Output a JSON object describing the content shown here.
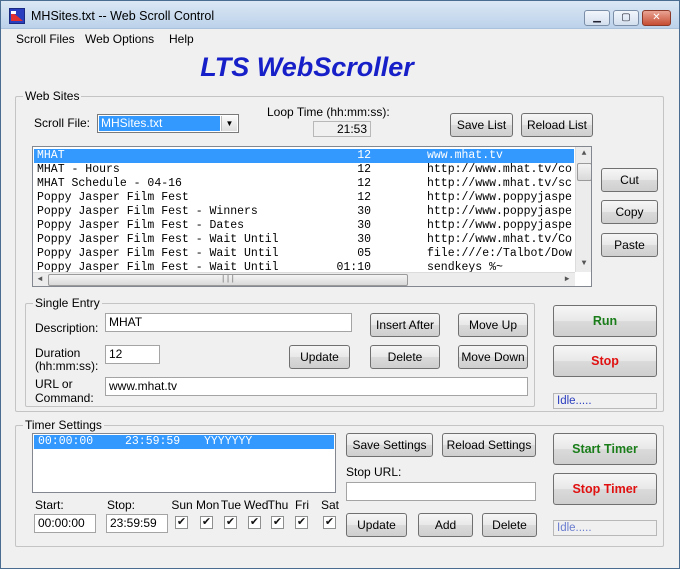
{
  "window": {
    "title": "MHSites.txt -- Web Scroll Control"
  },
  "menu": [
    "Scroll Files",
    "Web Options",
    "Help"
  ],
  "app_title": "LTS WebScroller",
  "web_sites": {
    "group_label": "Web Sites",
    "scroll_file_label": "Scroll File:",
    "scroll_file_value": "MHSites.txt",
    "loop_time_label": "Loop Time (hh:mm:ss):",
    "loop_time_value": "21:53",
    "save_list": "Save List",
    "reload_list": "Reload List",
    "rows": [
      {
        "desc": "MHAT",
        "time": "12",
        "url": "www.mhat.tv",
        "selected": true
      },
      {
        "desc": "MHAT - Hours",
        "time": "12",
        "url": "http://www.mhat.tv/co"
      },
      {
        "desc": "MHAT Schedule - 04-16",
        "time": "12",
        "url": "http://www.mhat.tv/sc"
      },
      {
        "desc": "Poppy Jasper Film Fest",
        "time": "12",
        "url": "http://www.poppyjaspe"
      },
      {
        "desc": "Poppy Jasper Film Fest - Winners",
        "time": "30",
        "url": "http://www.poppyjaspe"
      },
      {
        "desc": "Poppy Jasper Film Fest - Dates",
        "time": "30",
        "url": "http://www.poppyjaspe"
      },
      {
        "desc": "Poppy Jasper Film Fest - Wait Until",
        "time": "30",
        "url": "http://www.mhat.tv/Co"
      },
      {
        "desc": "Poppy Jasper Film Fest - Wait Until",
        "time": "05",
        "url": "file:///e:/Talbot/Dow"
      },
      {
        "desc": "Poppy Jasper Film Fest - Wait Until",
        "time": "01:10",
        "url": "sendkeys %~"
      }
    ],
    "hscroll_grip": "|||"
  },
  "clipboard": {
    "cut": "Cut",
    "copy": "Copy",
    "paste": "Paste"
  },
  "single_entry": {
    "group_label": "Single Entry",
    "description_label": "Description:",
    "description_value": "MHAT",
    "duration_label_1": "Duration",
    "duration_label_2": "(hh:mm:ss):",
    "duration_value": "12",
    "url_label_1": "URL or",
    "url_label_2": "Command:",
    "url_value": "www.mhat.tv",
    "insert_after": "Insert After",
    "move_up": "Move Up",
    "update": "Update",
    "delete": "Delete",
    "move_down": "Move Down"
  },
  "run_controls": {
    "run": "Run",
    "stop": "Stop",
    "status": "Idle....."
  },
  "timer": {
    "group_label": "Timer Settings",
    "entry": {
      "start": "00:00:00",
      "stop": "23:59:59",
      "days": "YYYYYYY"
    },
    "save_settings": "Save Settings",
    "reload_settings": "Reload Settings",
    "stop_url_label": "Stop URL:",
    "stop_url_value": "",
    "start_label": "Start:",
    "stop_label": "Stop:",
    "start_value": "00:00:00",
    "stop_value": "23:59:59",
    "days": [
      {
        "label": "Sun",
        "checked": true
      },
      {
        "label": "Mon",
        "checked": true
      },
      {
        "label": "Tue",
        "checked": true
      },
      {
        "label": "Wed",
        "checked": true
      },
      {
        "label": "Thu",
        "checked": true
      },
      {
        "label": "Fri",
        "checked": true
      },
      {
        "label": "Sat",
        "checked": true
      }
    ],
    "check_glyph": "✔",
    "update": "Update",
    "add": "Add",
    "delete": "Delete"
  },
  "timer_controls": {
    "start_timer": "Start Timer",
    "stop_timer": "Stop Timer",
    "status": "Idle....."
  },
  "colors": {
    "accent_title": "#1720c8",
    "run_green": "#1a7d1a",
    "stop_red": "#e01010",
    "selection": "#3399ff"
  }
}
